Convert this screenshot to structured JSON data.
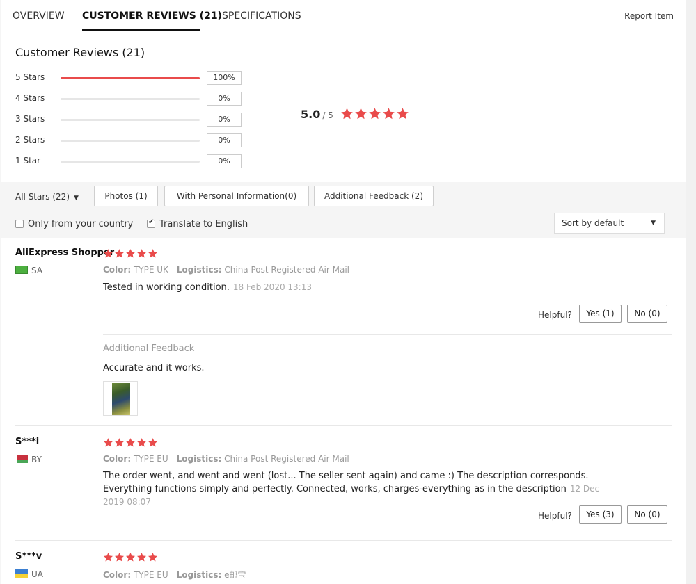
{
  "tabs": [
    {
      "label": "OVERVIEW"
    },
    {
      "label": "CUSTOMER REVIEWS (21)"
    },
    {
      "label": "SPECIFICATIONS"
    }
  ],
  "report_item": "Report Item",
  "section_title": "Customer Reviews (21)",
  "rating_breakdown": [
    {
      "label": "5 Stars",
      "percent": "100%",
      "fraction": 1.0
    },
    {
      "label": "4 Stars",
      "percent": "0%",
      "fraction": 0
    },
    {
      "label": "3 Stars",
      "percent": "0%",
      "fraction": 0
    },
    {
      "label": "2 Stars",
      "percent": "0%",
      "fraction": 0
    },
    {
      "label": "1 Star",
      "percent": "0%",
      "fraction": 0
    }
  ],
  "overall": {
    "score": "5.0",
    "out_of": "/ 5",
    "stars": 5
  },
  "filters": {
    "all_stars": "All Stars (22)",
    "photos": "Photos (1)",
    "personal_info": "With Personal Information(0)",
    "additional_feedback": "Additional Feedback (2)",
    "only_country": "Only from your country",
    "only_country_checked": false,
    "translate": "Translate to English",
    "translate_checked": true,
    "sort": "Sort by default"
  },
  "labels": {
    "color": "Color:",
    "logistics": "Logistics:",
    "helpful": "Helpful?",
    "additional_feedback_title": "Additional Feedback"
  },
  "reviews": [
    {
      "name": "AliExpress Shopper",
      "country": "SA",
      "stars": 5,
      "color": "TYPE UK",
      "logistics": "China Post Registered Air Mail",
      "text": "Tested in working condition.",
      "date": "18 Feb 2020 13:13",
      "yes": "Yes (1)",
      "no": "No (0)",
      "additional": "Accurate and it works."
    },
    {
      "name": "S***i",
      "country": "BY",
      "stars": 5,
      "color": "TYPE EU",
      "logistics": "China Post Registered Air Mail",
      "text": "The order went, and went and went (lost... The seller sent again) and came :) The description corresponds. Everything functions simply and perfectly. Connected, works, charges-everything as in the description",
      "date": "12 Dec 2019 08:07",
      "yes": "Yes (3)",
      "no": "No (0)"
    },
    {
      "name": "S***v",
      "country": "UA",
      "stars": 5,
      "color": "TYPE EU",
      "logistics": "e邮宝"
    }
  ],
  "colors": {
    "accent_red": "#e94b4b",
    "tab_underline": "#111111"
  }
}
